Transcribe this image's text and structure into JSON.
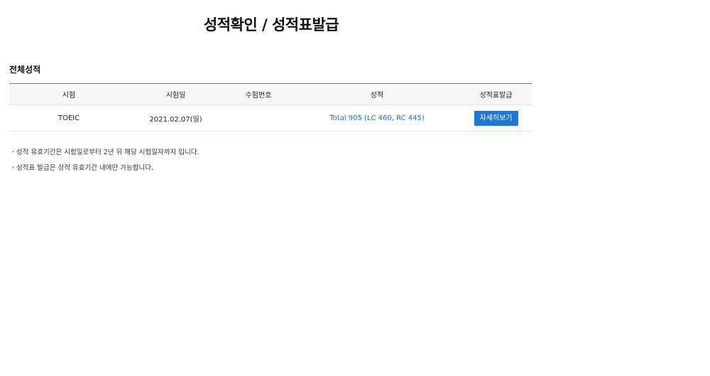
{
  "header": {
    "title": "성적확인 / 성적표발급"
  },
  "section": {
    "title": "전체성적"
  },
  "table": {
    "headers": [
      "시험",
      "시험일",
      "수험번호",
      "성적",
      "성적표발급"
    ],
    "rows": [
      {
        "exam": "TOEIC",
        "date": "2021.02.07(일)",
        "registration_number": "",
        "score": "Total 905 (LC 460, RC 445)",
        "action_label": "자세히보기"
      }
    ]
  },
  "notes": [
    "성적 유효기간은 시험일로부터 2년 뒤 해당 시험일자까지 입니다.",
    "성적표 발급은 성적 유효기간 내에만 가능합니다."
  ],
  "colors": {
    "link": "#2a6ebb",
    "button": "#1f74d4",
    "header_row_bg": "#f7f7f7"
  }
}
